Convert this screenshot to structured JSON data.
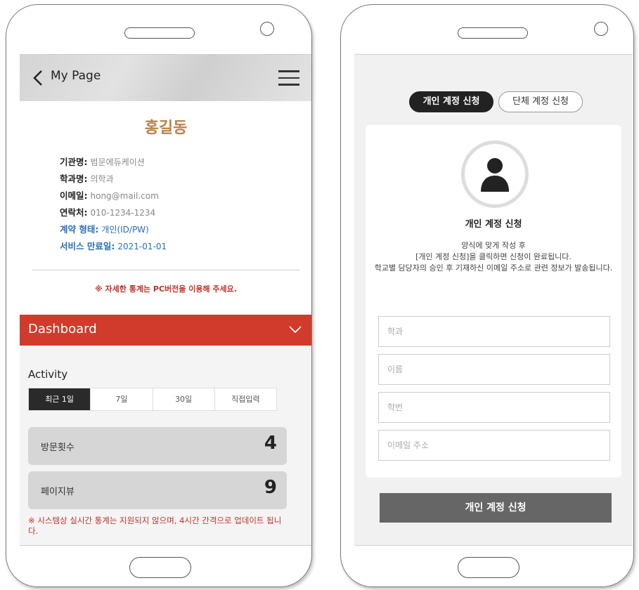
{
  "left_screen": {
    "header": {
      "title": "My Page",
      "back_icon": "chevron-left-icon",
      "menu_icon": "hamburger-icon"
    },
    "profile": {
      "name": "홍길동",
      "rows": [
        {
          "label": "기관명:",
          "value": "범문에듀케이션"
        },
        {
          "label": "학과명:",
          "value": "의학과"
        },
        {
          "label": "이메일:",
          "value": "hong@mail.com"
        },
        {
          "label": "연락처:",
          "value": "010-1234-1234"
        },
        {
          "label": "계약 형태:",
          "value": "개인(ID/PW)"
        },
        {
          "label": "서비스 만료일:",
          "value": "2021-01-01"
        }
      ],
      "note": "※ 자세한 통계는 PC버전을 이용해 주세요."
    },
    "dashboard": {
      "label": "Dashboard"
    },
    "activity": {
      "title": "Activity",
      "tabs": [
        "최근 1일",
        "7일",
        "30일",
        "직접입력"
      ],
      "active_tab": "최근 1일",
      "stats": [
        {
          "label": "방문횟수",
          "value": "4"
        },
        {
          "label": "페이지뷰",
          "value": "9"
        }
      ],
      "footnote": "※ 시스템상 실시간 통계는 지원되지 않으며, 4시간 간격으로 업데이트 됩니다."
    }
  },
  "right_screen": {
    "segments": {
      "individual": "개인 계정 신청",
      "group": "단체 계정 신청"
    },
    "card": {
      "title": "개인 계정 신청",
      "desc_line1": "양식에 맞게 작성 후",
      "desc_line2": "[개인 계정 신청]을 클릭하면 신청이 완료됩니다.",
      "desc_line3": "학교별 담당자의 승인 후 기재하신 이메일 주소로 관련 정보가 발송됩니다.",
      "fields": {
        "department": "학과",
        "name": "이름",
        "student_id": "학번",
        "email": "이메일 주소"
      }
    },
    "submit_label": "개인 계정 신청"
  },
  "colors": {
    "accent_red": "#d13b2c",
    "name_gold": "#b8834a",
    "link_blue": "#2a6fb5"
  }
}
